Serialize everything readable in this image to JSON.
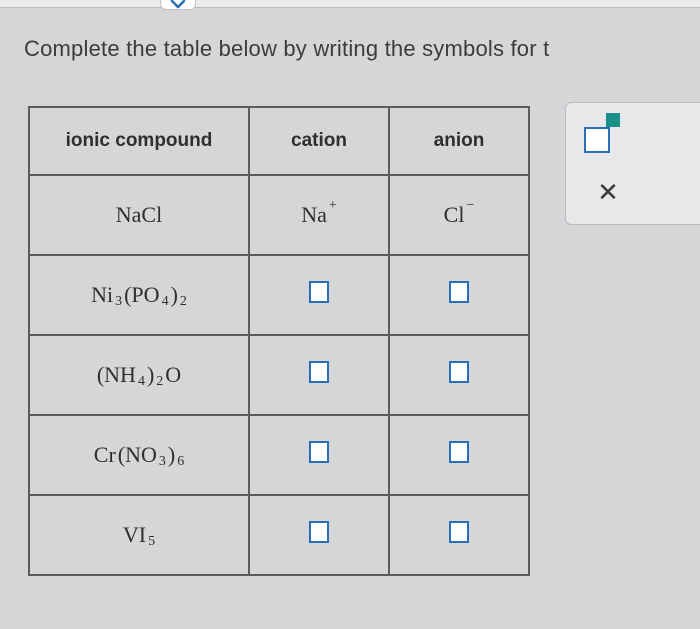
{
  "prompt": "Complete the table below by writing the symbols for t",
  "table": {
    "headers": [
      "ionic compound",
      "cation",
      "anion"
    ],
    "rows": [
      {
        "compound": {
          "parts": [
            "NaCl"
          ]
        },
        "cation": {
          "parts": [
            "Na",
            {
              "sup": "+"
            }
          ]
        },
        "anion": {
          "parts": [
            "Cl",
            {
              "sup": "−"
            }
          ]
        }
      },
      {
        "compound": {
          "parts": [
            "Ni",
            {
              "sub": "3"
            },
            "(PO",
            {
              "sub": "4"
            },
            ")",
            {
              "sub": "2"
            }
          ]
        },
        "cation": {
          "input": true
        },
        "anion": {
          "input": true
        }
      },
      {
        "compound": {
          "parts": [
            "(NH",
            {
              "sub": "4"
            },
            ")",
            {
              "sub": "2"
            },
            "O"
          ]
        },
        "cation": {
          "input": true
        },
        "anion": {
          "input": true
        }
      },
      {
        "compound": {
          "parts": [
            "Cr",
            "(NO",
            {
              "sub": "3"
            },
            ")",
            {
              "sub": "6"
            }
          ]
        },
        "cation": {
          "input": true
        },
        "anion": {
          "input": true
        }
      },
      {
        "compound": {
          "parts": [
            "VI",
            {
              "sub": "5"
            }
          ]
        },
        "cation": {
          "input": true
        },
        "anion": {
          "input": true
        }
      }
    ]
  },
  "tools": {
    "superscript_tool": "superscript-box",
    "close_label": "✕"
  },
  "chevron": "expand"
}
